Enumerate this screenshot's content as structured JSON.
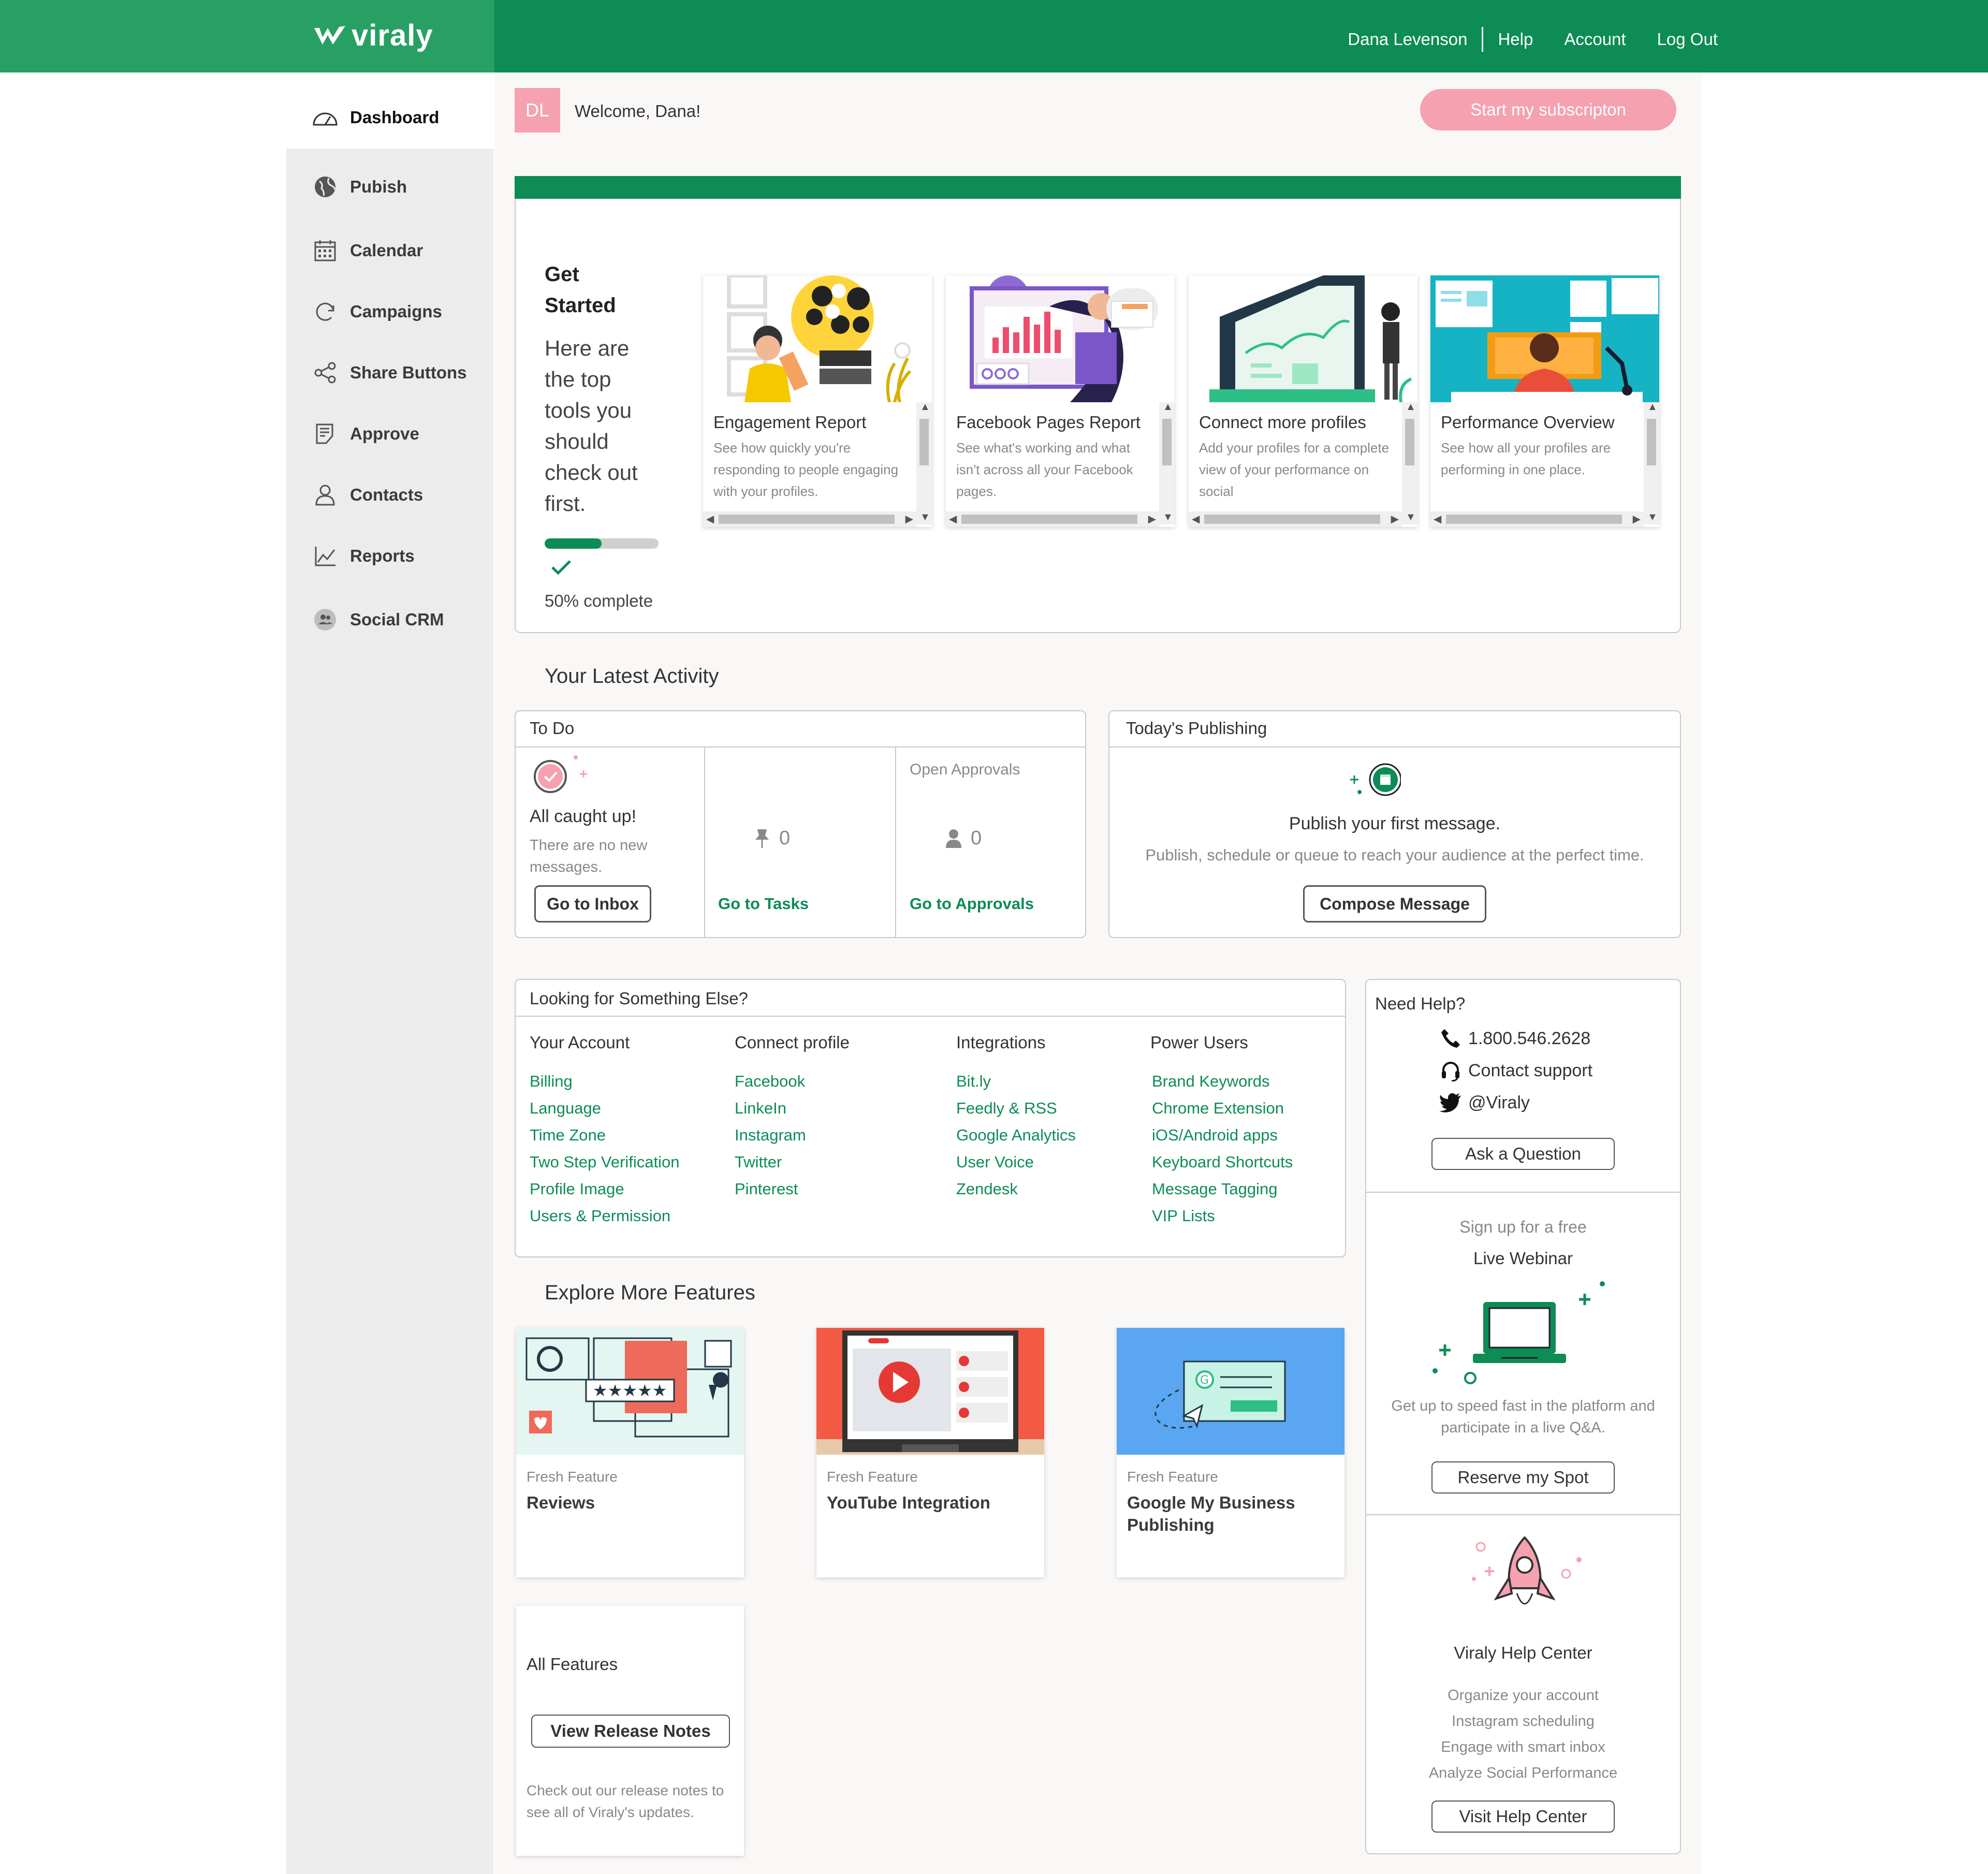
{
  "topbar": {
    "brand": "viraly",
    "user_name": "Dana Levenson",
    "help": "Help",
    "account": "Account",
    "logout": "Log Out",
    "brand_color": "#0d8c55"
  },
  "sidebar": {
    "items": [
      {
        "label": "Dashboard",
        "icon": "speedometer-icon"
      },
      {
        "label": "Pubish",
        "icon": "globe-icon"
      },
      {
        "label": "Calendar",
        "icon": "calendar-icon"
      },
      {
        "label": "Campaigns",
        "icon": "refresh-icon"
      },
      {
        "label": "Share Buttons",
        "icon": "share-icon"
      },
      {
        "label": "Approve",
        "icon": "approve-icon"
      },
      {
        "label": "Contacts",
        "icon": "user-icon"
      },
      {
        "label": "Reports",
        "icon": "chart-icon"
      },
      {
        "label": "Social CRM",
        "icon": "people-icon"
      }
    ]
  },
  "header": {
    "avatar": "DL",
    "welcome": "Welcome, Dana!",
    "cta": "Start my subscripton"
  },
  "get_started": {
    "title_1": "Get",
    "title_2": "Started",
    "desc_lines": [
      "Here are",
      "the top",
      "tools you",
      "should",
      "check out",
      "first."
    ],
    "progress": 0.5,
    "progress_label": "50% complete",
    "cards": [
      {
        "title": "Engagement Report",
        "desc": "See how quickly you're responding to people engaging with your profiles."
      },
      {
        "title": "Facebook Pages Report",
        "desc": "See what's working and what isn't across all your Facebook pages."
      },
      {
        "title": "Connect more profiles",
        "desc": "Add your profiles for a complete view of your performance on social"
      },
      {
        "title": "Performance Overview",
        "desc": "See how all your profiles are performing in one place."
      }
    ]
  },
  "activity": {
    "title": "Your Latest Activity",
    "todo": {
      "header": "To Do",
      "caught_up": "All caught up!",
      "no_messages": "There are no new messages.",
      "inbox_btn": "Go to Inbox",
      "tasks_count": "0",
      "tasks_link": "Go to Tasks",
      "approvals_label": "Open Approvals",
      "approvals_count": "0",
      "approvals_link": "Go to Approvals"
    },
    "publishing": {
      "header": "Today's Publishing",
      "title": "Publish your first message.",
      "desc": "Publish, schedule or queue to reach your audience at the perfect time.",
      "btn": "Compose Message"
    }
  },
  "looking": {
    "header": "Looking for Something Else?",
    "columns": [
      {
        "heading": "Your Account",
        "links": [
          "Billing",
          "Language",
          "Time Zone",
          "Two Step Verification",
          "Profile Image",
          "Users & Permission"
        ]
      },
      {
        "heading": "Connect profile",
        "links": [
          "Facebook",
          "LinkeIn",
          "Instagram",
          "Twitter",
          "Pinterest"
        ]
      },
      {
        "heading": "Integrations",
        "links": [
          "Bit.ly",
          "Feedly & RSS",
          "Google Analytics",
          "User Voice",
          "Zendesk"
        ]
      },
      {
        "heading": "Power Users",
        "links": [
          "Brand Keywords",
          "Chrome Extension",
          "iOS/Android apps",
          "Keyboard Shortcuts",
          "Message Tagging",
          "VIP Lists"
        ]
      }
    ]
  },
  "explore": {
    "title": "Explore More Features",
    "features": [
      {
        "kicker": "Fresh Feature",
        "name": "Reviews"
      },
      {
        "kicker": "Fresh Feature",
        "name": "YouTube Integration"
      },
      {
        "kicker": "Fresh Feature",
        "name": "Google My Business Publishing"
      }
    ],
    "all_features": {
      "title": "All Features",
      "btn": "View Release Notes",
      "desc": "Check out our release notes to see all of Viraly's updates."
    }
  },
  "help": {
    "title": "Need Help?",
    "phone": "1.800.546.2628",
    "support": "Contact support",
    "twitter": "@Viraly",
    "ask_btn": "Ask a Question",
    "webinar_kicker": "Sign up for a free",
    "webinar_title": "Live Webinar",
    "webinar_desc": "Get up to speed fast in the platform and participate in a live Q&A.",
    "webinar_btn": "Reserve my Spot",
    "center_title": "Viraly Help Center",
    "center_items": [
      "Organize your account",
      "Instagram scheduling",
      "Engage with smart inbox",
      "Analyze Social Performance"
    ],
    "center_btn": "Visit Help Center"
  }
}
